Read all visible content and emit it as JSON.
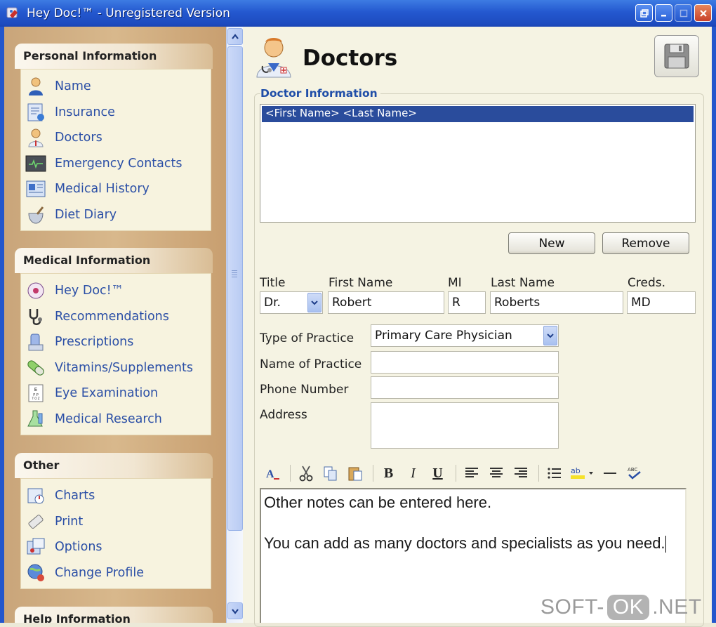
{
  "window": {
    "title": "Hey Doc!™ - Unregistered Version",
    "buttons": [
      "restore",
      "minimize",
      "maximize",
      "close"
    ]
  },
  "sidebar": {
    "sections": [
      {
        "title": "Personal Information",
        "items": [
          {
            "label": "Name",
            "icon": "person-icon"
          },
          {
            "label": "Insurance",
            "icon": "insurance-card-icon"
          },
          {
            "label": "Doctors",
            "icon": "doctor-icon"
          },
          {
            "label": "Emergency Contacts",
            "icon": "phone-icon"
          },
          {
            "label": "Medical History",
            "icon": "medical-history-icon"
          },
          {
            "label": "Diet Diary",
            "icon": "mortar-pestle-icon"
          }
        ]
      },
      {
        "title": "Medical Information",
        "items": [
          {
            "label": "Hey Doc!™",
            "icon": "hey-doc-icon"
          },
          {
            "label": "Recommendations",
            "icon": "stethoscope-icon"
          },
          {
            "label": "Prescriptions",
            "icon": "prescription-icon"
          },
          {
            "label": "Vitamins/Supplements",
            "icon": "pill-icon"
          },
          {
            "label": "Eye Examination",
            "icon": "eye-chart-icon"
          },
          {
            "label": "Medical Research",
            "icon": "flask-icon"
          }
        ]
      },
      {
        "title": "Other",
        "items": [
          {
            "label": "Charts",
            "icon": "chart-icon"
          },
          {
            "label": "Print",
            "icon": "print-icon"
          },
          {
            "label": "Options",
            "icon": "options-icon"
          },
          {
            "label": "Change Profile",
            "icon": "change-profile-icon"
          }
        ]
      },
      {
        "title": "Help Information",
        "items": []
      }
    ]
  },
  "page": {
    "title": "Doctors",
    "group_label": "Doctor Information",
    "list_items": [
      "<First Name> <Last Name>"
    ],
    "new_label": "New",
    "remove_label": "Remove"
  },
  "form": {
    "title_label": "Title",
    "title_value": "Dr.",
    "first_name_label": "First Name",
    "first_name_value": "Robert",
    "mi_label": "MI",
    "mi_value": "R",
    "last_name_label": "Last Name",
    "last_name_value": "Roberts",
    "creds_label": "Creds.",
    "creds_value": "MD",
    "practice_type_label": "Type of Practice",
    "practice_type_value": "Primary Care Physician",
    "practice_name_label": "Name of Practice",
    "practice_name_value": "",
    "phone_label": "Phone Number",
    "phone_value": "",
    "address_label": "Address",
    "address_value": ""
  },
  "editor": {
    "toolbar": [
      "font-icon",
      "cut-icon",
      "copy-icon",
      "paste-icon",
      "bold-icon",
      "italic-icon",
      "underline-icon",
      "align-left-icon",
      "align-center-icon",
      "align-right-icon",
      "bullet-list-icon",
      "highlight-icon",
      "horizontal-rule-icon",
      "spellcheck-icon"
    ],
    "line1": "Other notes can be entered here.",
    "line2": "You can add as many doctors and specialists as you need."
  },
  "watermark": {
    "left": "SOFT-",
    "mid": "OK",
    "right": ".NET"
  },
  "colors": {
    "titlebar": "#2458cf",
    "link": "#2b4fa6",
    "selection": "#2a4c9c",
    "group_label": "#1f4ea8"
  }
}
